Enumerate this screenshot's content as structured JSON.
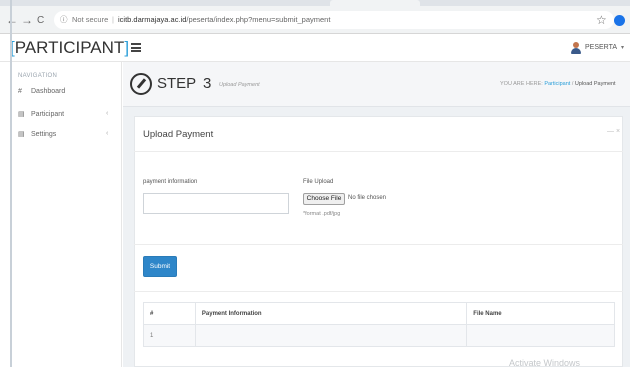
{
  "browser": {
    "back_icon": "←",
    "forward_icon": "→",
    "reload_icon": "C",
    "info_icon": "ⓘ",
    "security_text": "Not secure",
    "url_host": "icitb.darmajaya.ac.id",
    "url_path": "/peserta/index.php?menu=submit_payment",
    "star_icon": "☆",
    "profile_initial": ""
  },
  "header": {
    "brand_open": "[",
    "brand_text": "PARTICIPANT",
    "brand_close": "]",
    "user_name": "PESERTA",
    "user_caret": "▾"
  },
  "sidebar": {
    "heading": "NAVIGATION",
    "items": [
      {
        "icon": "#",
        "label": "Dashboard",
        "chevron": ""
      },
      {
        "icon": "▤",
        "label": "Participant",
        "chevron": "‹"
      },
      {
        "icon": "▤",
        "label": "Settings",
        "chevron": "‹"
      }
    ]
  },
  "page": {
    "step_label": "STEP",
    "step_number": "3",
    "step_sub": "Upload Payment",
    "crumb_prefix": "YOU ARE HERE:",
    "crumb_link": "Participant",
    "crumb_sep": "/",
    "crumb_current": "Upload Payment"
  },
  "panel": {
    "title": "Upload Payment",
    "tools": "— ×",
    "payment_label": "payment information",
    "payment_value": "",
    "file_label": "File Upload",
    "choose_label": "Choose File",
    "no_file_text": "No file chosen",
    "format_hint": "*format .pdf/jpg",
    "submit_label": "Submit"
  },
  "table": {
    "headers": [
      "#",
      "Payment Information",
      "File Name"
    ],
    "rows": [
      [
        "1",
        "",
        ""
      ]
    ]
  },
  "watermark": "Activate Windows",
  "colors": {
    "accent": "#2b9fd9",
    "submit": "#2e86c9",
    "background": "#eef1f4"
  }
}
